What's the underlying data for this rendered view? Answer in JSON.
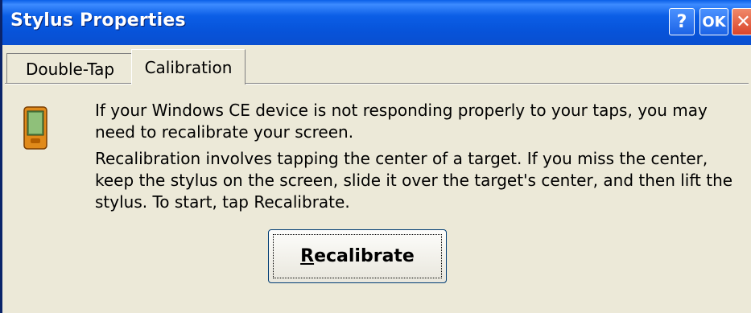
{
  "window": {
    "title": "Stylus Properties"
  },
  "titlebar_buttons": {
    "help": "?",
    "ok": "OK",
    "close": "✕"
  },
  "tabs": [
    {
      "label": "Double-Tap",
      "active": false
    },
    {
      "label": "Calibration",
      "active": true
    }
  ],
  "content": {
    "icon": "pda-device-icon",
    "paragraph1": "If your Windows CE device is not responding properly to your taps, you may need to recalibrate your screen.",
    "paragraph2": "Recalibration involves tapping the center of a target. If you miss the center, keep the stylus on the screen, slide it over the target's center, and then lift the stylus. To start, tap Recalibrate.",
    "button_label_mnemonic": "R",
    "button_label_rest": "ecalibrate"
  },
  "colors": {
    "titlebar": "#0753d9",
    "dialog_bg": "#ece9d8",
    "close": "#d9442a"
  }
}
